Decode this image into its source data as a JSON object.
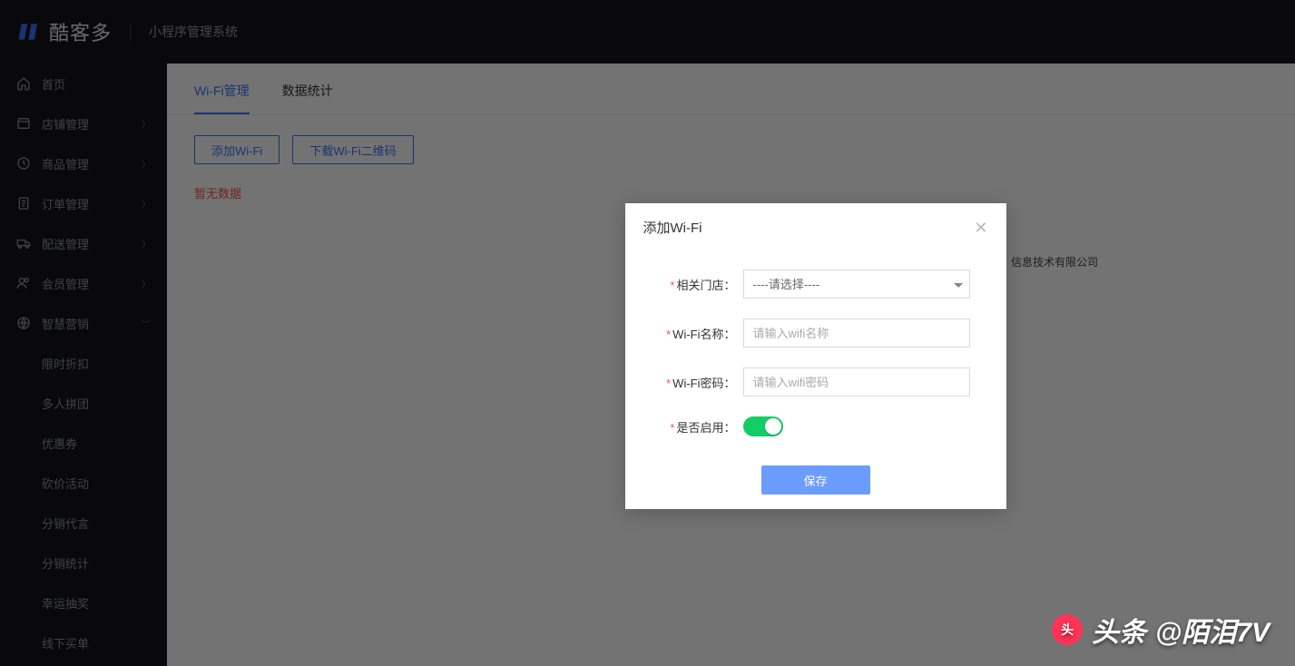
{
  "header": {
    "brand": "酷客多",
    "subtitle": "小程序管理系统"
  },
  "sidebar": {
    "items": [
      {
        "label": "首页",
        "icon": "home",
        "expandable": false
      },
      {
        "label": "店铺管理",
        "icon": "shop",
        "expandable": true
      },
      {
        "label": "商品管理",
        "icon": "goods",
        "expandable": true
      },
      {
        "label": "订单管理",
        "icon": "order",
        "expandable": true
      },
      {
        "label": "配送管理",
        "icon": "delivery",
        "expandable": true
      },
      {
        "label": "会员管理",
        "icon": "member",
        "expandable": true
      },
      {
        "label": "智慧营销",
        "icon": "marketing",
        "expandable": true,
        "expanded": true,
        "children": [
          "限时折扣",
          "多人拼团",
          "优惠券",
          "砍价活动",
          "分销代言",
          "分销统计",
          "幸运抽奖",
          "线下买单"
        ]
      }
    ]
  },
  "main": {
    "tabs": [
      {
        "label": "Wi-Fi管理",
        "active": true
      },
      {
        "label": "数据统计",
        "active": false
      }
    ],
    "buttons": {
      "add_wifi": "添加Wi-Fi",
      "download_qr": "下载Wi-Fi二维码"
    },
    "no_data": "暂无数据",
    "footer_company": "信息技术有限公司"
  },
  "modal": {
    "title": "添加Wi-Fi",
    "fields": {
      "store_label": "相关门店：",
      "store_placeholder": "----请选择----",
      "name_label": "Wi-Fi名称：",
      "name_placeholder": "请输入wifi名称",
      "pwd_label": "Wi-Fi密码：",
      "pwd_placeholder": "请输入wifi密码",
      "enable_label": "是否启用：",
      "enabled": true
    },
    "save": "保存"
  },
  "watermark": {
    "prefix": "头条",
    "handle": "@陌泪7V"
  }
}
